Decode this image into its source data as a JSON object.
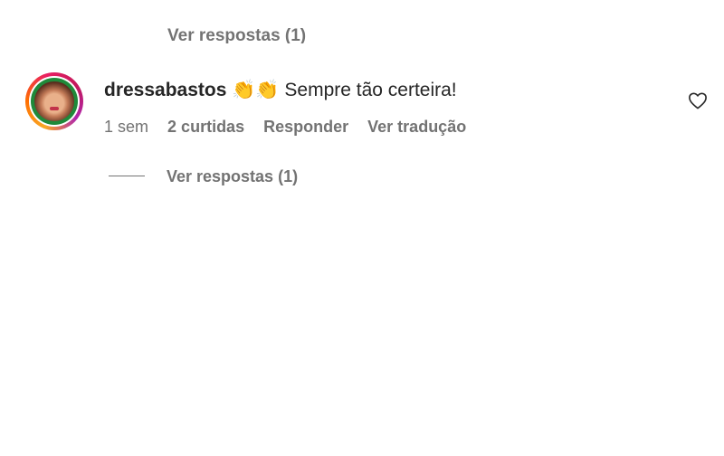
{
  "previous_thread": {
    "view_replies_label": "Ver respostas (1)"
  },
  "comment": {
    "username": "dressabastos",
    "emoji": "👏👏",
    "text": "Sempre tão certeira!",
    "time": "1 sem",
    "likes": "2 curtidas",
    "reply_label": "Responder",
    "translate_label": "Ver tradução",
    "view_replies_label": "Ver respostas (1)",
    "like_icon": "heart-outline-icon"
  },
  "colors": {
    "text_primary": "#262626",
    "text_secondary": "#737373",
    "story_ring_start": "#f9a825",
    "story_ring_end": "#b026ad",
    "close_friends_ring": "#1f8a3a"
  }
}
